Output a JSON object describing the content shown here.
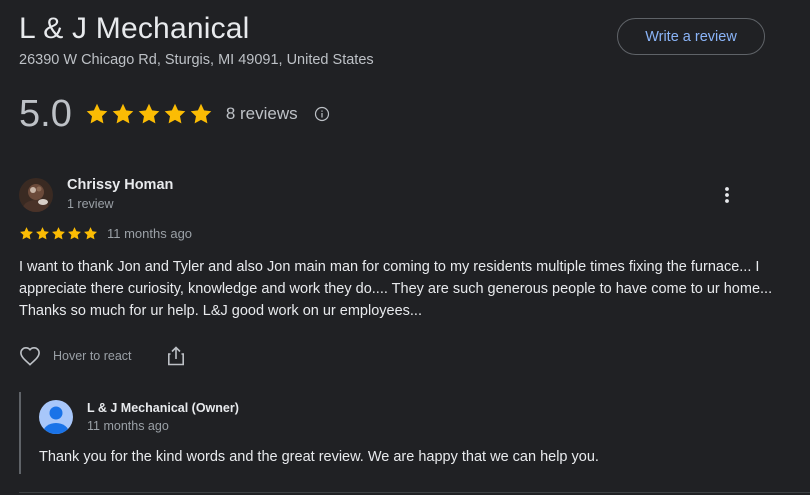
{
  "place": {
    "name": "L & J Mechanical",
    "address": "26390 W Chicago Rd, Sturgis, MI 49091, United States",
    "write_review_label": "Write a review",
    "rating": "5.0",
    "stars": 5,
    "reviews_count_label": "8 reviews"
  },
  "review": {
    "author": "Chrissy Homan",
    "author_meta": "1 review",
    "stars": 5,
    "date": "11 months ago",
    "text": "I want to thank Jon and Tyler and also Jon main man for coming to my residents multiple times fixing the furnace... I appreciate there curiosity, knowledge and work they do.... They are such generous people to have come to ur home... Thanks so much for ur help. L&J good work on ur employees...",
    "react_label": "Hover to react"
  },
  "owner_reply": {
    "author": "L & J Mechanical (Owner)",
    "date": "11 months ago",
    "text": "Thank you for the kind words and the great review. We are happy that we can help you."
  },
  "colors": {
    "background": "#202124",
    "star": "#fbbc04",
    "link": "#8ab4f8",
    "text_primary": "#e8eaed",
    "text_secondary": "#9aa0a6"
  },
  "icons": {
    "star": "star-icon",
    "info": "info-icon",
    "more": "more-vert-icon",
    "react": "heart-icon",
    "share": "share-icon",
    "owner_avatar": "person-avatar-icon"
  }
}
